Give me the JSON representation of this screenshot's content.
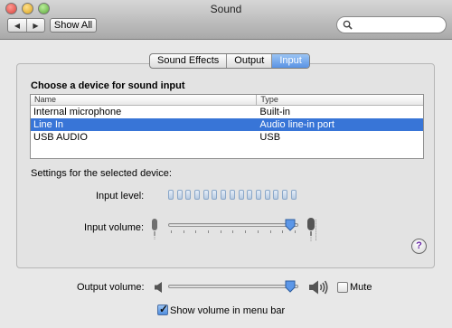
{
  "window": {
    "title": "Sound"
  },
  "toolbar": {
    "back_icon": "back-arrow-icon",
    "forward_icon": "forward-arrow-icon",
    "show_all": "Show All",
    "search_placeholder": ""
  },
  "tabs": [
    {
      "label": "Sound Effects",
      "selected": false
    },
    {
      "label": "Output",
      "selected": false
    },
    {
      "label": "Input",
      "selected": true
    }
  ],
  "input": {
    "heading": "Choose a device for sound input",
    "columns": {
      "name": "Name",
      "type": "Type"
    },
    "devices": [
      {
        "name": "Internal microphone",
        "type": "Built-in",
        "selected": false
      },
      {
        "name": "Line In",
        "type": "Audio line-in port",
        "selected": true
      },
      {
        "name": "USB  AUDIO",
        "type": "USB",
        "selected": false
      }
    ],
    "settings_label": "Settings for the selected device:",
    "input_level_label": "Input level:",
    "input_level_segments": 15,
    "input_level_lit": 0,
    "input_volume_label": "Input volume:",
    "input_volume_fraction": 0.98
  },
  "help": {
    "label": "?"
  },
  "output": {
    "volume_label": "Output volume:",
    "volume_fraction": 0.98,
    "mute_label": "Mute",
    "mute_checked": false,
    "show_volume_label": "Show volume in menu bar",
    "show_volume_checked": true
  }
}
